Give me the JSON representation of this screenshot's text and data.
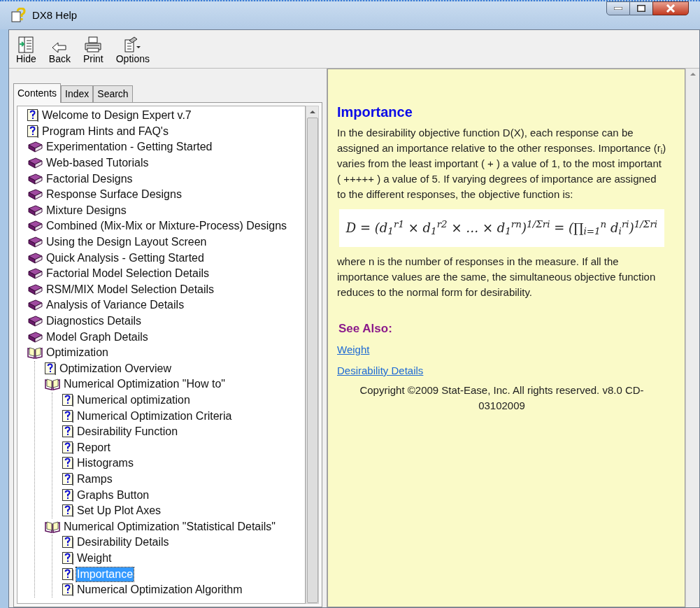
{
  "window": {
    "title": "DX8 Help"
  },
  "toolbar": [
    {
      "label": "Hide",
      "kind": "hide"
    },
    {
      "label": "Back",
      "kind": "back"
    },
    {
      "label": "Print",
      "kind": "print"
    },
    {
      "label": "Options",
      "kind": "options"
    }
  ],
  "tabs": [
    {
      "label": "Contents",
      "selected": true
    },
    {
      "label": "Index",
      "selected": false
    },
    {
      "label": "Search",
      "selected": false
    }
  ],
  "tree": [
    {
      "label": "Welcome to Design Expert v.7",
      "kind": "page",
      "selected": false
    },
    {
      "label": "Program Hints and FAQ's",
      "kind": "page",
      "selected": false
    },
    {
      "label": "Experimentation - Getting Started",
      "kind": "book",
      "expanded": false
    },
    {
      "label": "Web-based Tutorials",
      "kind": "book",
      "expanded": false
    },
    {
      "label": "Factorial Designs",
      "kind": "book",
      "expanded": false
    },
    {
      "label": "Response Surface Designs",
      "kind": "book",
      "expanded": false
    },
    {
      "label": "Mixture Designs",
      "kind": "book",
      "expanded": false
    },
    {
      "label": "Combined (Mix-Mix or Mixture-Process) Designs",
      "kind": "book",
      "expanded": false
    },
    {
      "label": "Using the Design Layout Screen",
      "kind": "book",
      "expanded": false
    },
    {
      "label": "Quick Analysis - Getting Started",
      "kind": "book",
      "expanded": false
    },
    {
      "label": "Factorial Model Selection Details",
      "kind": "book",
      "expanded": false
    },
    {
      "label": "RSM/MIX Model Selection Details",
      "kind": "book",
      "expanded": false
    },
    {
      "label": "Analysis of Variance Details",
      "kind": "book",
      "expanded": false
    },
    {
      "label": "Diagnostics Details",
      "kind": "book",
      "expanded": false
    },
    {
      "label": "Model Graph Details",
      "kind": "book",
      "expanded": false
    },
    {
      "label": "Optimization",
      "kind": "book",
      "expanded": true,
      "children": [
        {
          "label": "Optimization Overview",
          "kind": "page",
          "selected": false
        },
        {
          "label": "Numerical Optimization \"How to\"",
          "kind": "book",
          "expanded": true,
          "children": [
            {
              "label": "Numerical optimization",
              "kind": "page",
              "selected": false
            },
            {
              "label": "Numerical Optimization Criteria",
              "kind": "page",
              "selected": false
            },
            {
              "label": "Desirability Function",
              "kind": "page",
              "selected": false
            },
            {
              "label": "Report",
              "kind": "page",
              "selected": false
            },
            {
              "label": "Histograms",
              "kind": "page",
              "selected": false
            },
            {
              "label": "Ramps",
              "kind": "page",
              "selected": false
            },
            {
              "label": "Graphs Button",
              "kind": "page",
              "selected": false
            },
            {
              "label": "Set Up Plot Axes",
              "kind": "page",
              "selected": false
            }
          ]
        },
        {
          "label": "Numerical Optimization \"Statistical Details\"",
          "kind": "book",
          "expanded": true,
          "children": [
            {
              "label": "Desirability Details",
              "kind": "page",
              "selected": false
            },
            {
              "label": "Weight",
              "kind": "page",
              "selected": false
            },
            {
              "label": "Importance",
              "kind": "page",
              "selected": true
            },
            {
              "label": "Numerical Optimization Algorithm",
              "kind": "page",
              "selected": false
            }
          ]
        }
      ]
    }
  ],
  "topic": {
    "title": "Importance",
    "intro": "In the desirability objective function D(X), each response can be assigned an importance relative to the other responses. Importance (r$_{i}$) varies from the least important ( + ) a value of 1, to the most important ( +++++ ) a value of 5. If varying degrees of importance are assigned to the different responses, the objective function is:",
    "formula": "D = (d$_{1}$$^{r1}$ × d$_{1}$$^{r2}$ × … × d$_{1}$$^{rn}$)$^{1/Σri}$ = (∏$_{i=1}$$^{n}$ d$_{i}$$^{ri}$)$^{1/Σri}$",
    "body": "where n is the number of responses in the measure. If all the importance values are the same, the simultaneous objective function reduces to the normal form for desirability.",
    "see_also_title": "See Also:",
    "links": [
      "Weight",
      "Desirability Details"
    ],
    "copyright": "Copyright ©2009  Stat-Ease, Inc. All rights reserved. v8.0 CD-03102009"
  }
}
